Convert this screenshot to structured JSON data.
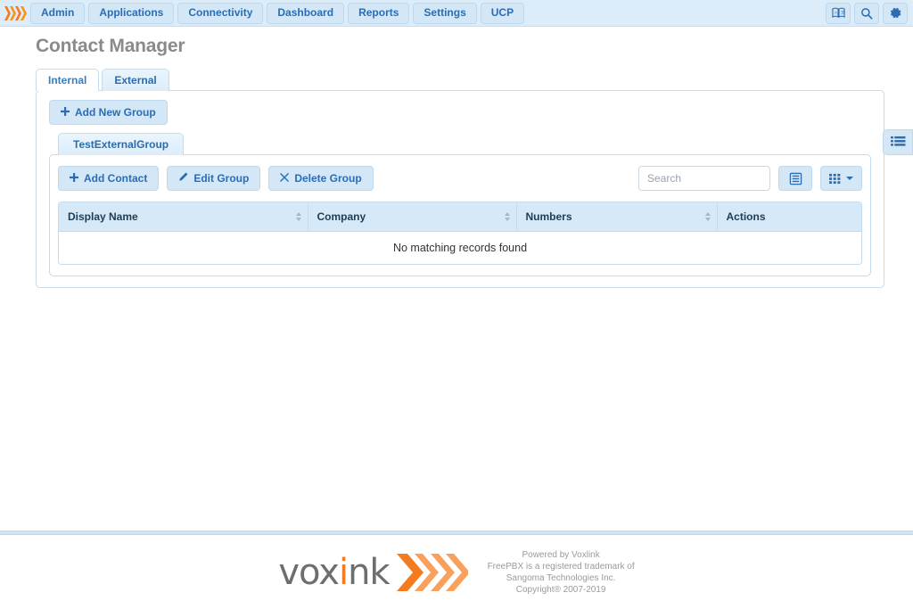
{
  "navbar": {
    "logo_icon": "freepbx-waves-logo",
    "items": [
      {
        "label": "Admin",
        "name": "nav-item-admin"
      },
      {
        "label": "Applications",
        "name": "nav-item-applications"
      },
      {
        "label": "Connectivity",
        "name": "nav-item-connectivity"
      },
      {
        "label": "Dashboard",
        "name": "nav-item-dashboard"
      },
      {
        "label": "Reports",
        "name": "nav-item-reports"
      },
      {
        "label": "Settings",
        "name": "nav-item-settings"
      },
      {
        "label": "UCP",
        "name": "nav-item-ucp"
      }
    ],
    "right_icons": [
      {
        "name": "language-icon",
        "title": "Language"
      },
      {
        "name": "search-icon",
        "title": "Search"
      },
      {
        "name": "gear-icon",
        "title": "Settings"
      }
    ]
  },
  "page": {
    "title": "Contact Manager"
  },
  "tabs": [
    {
      "label": "Internal",
      "active": false
    },
    {
      "label": "External",
      "active": true
    }
  ],
  "outer_panel": {
    "add_new_group_label": "Add New Group",
    "add_new_group_icon": "plus-icon"
  },
  "group_tabs": [
    {
      "label": "TestExternalGroup",
      "active": true
    }
  ],
  "toolbar": {
    "add_contact_label": "Add Contact",
    "add_contact_icon": "plus-icon",
    "edit_group_label": "Edit Group",
    "edit_group_icon": "pencil-icon",
    "delete_group_label": "Delete Group",
    "delete_group_icon": "x-icon",
    "search_placeholder": "Search",
    "search_value": "",
    "list_view_icon": "list-view-icon",
    "column_chooser_icon": "grid-columns-icon"
  },
  "table": {
    "columns": [
      {
        "label": "Display Name",
        "sortable": true
      },
      {
        "label": "Company",
        "sortable": true
      },
      {
        "label": "Numbers",
        "sortable": true
      },
      {
        "label": "Actions",
        "sortable": false
      }
    ],
    "rows": [],
    "empty_message": "No matching records found"
  },
  "side_toggle": {
    "icon": "list-menu-icon"
  },
  "footer": {
    "logo_text_part1": "vox",
    "logo_text_i": "i",
    "logo_text_part2": "nk",
    "logo_icon": "voxlink-waves-logo",
    "line1": "Powered by Voxlink",
    "line2": "FreePBX is a registered trademark of",
    "line3": "Sangoma Technologies Inc.",
    "line4": "Copyright® 2007-2019"
  },
  "colors": {
    "nav_bg": "#dcecf9",
    "accent_blue": "#2b6cb5",
    "panel_border": "#c3dcf0",
    "table_header_bg": "#d6e9f8",
    "brand_orange": "#f47b20",
    "title_gray": "#8a8a8a"
  }
}
